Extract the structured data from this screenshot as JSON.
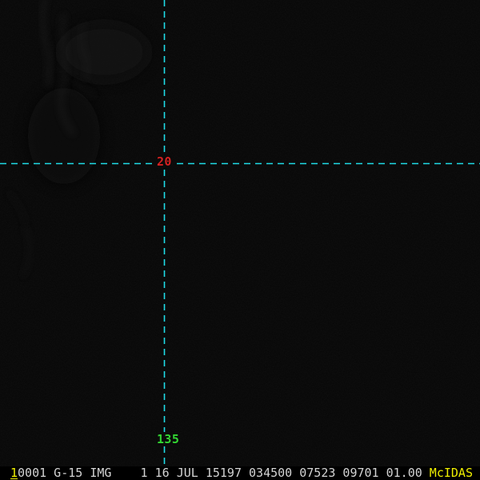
{
  "app": {
    "name": "McIDAS satellite image display"
  },
  "colors": {
    "background": "#060606",
    "status_bar_bg": "#000000",
    "crosshair": "#1fdde8",
    "latitude_label": "#d42222",
    "longitude_label": "#33d633",
    "status_text": "#d4d4d4",
    "accent_yellow": "#f0f000"
  },
  "crosshair": {
    "latitude_label": "20",
    "longitude_label": "135"
  },
  "status_bar": {
    "frame_number": "1",
    "info_text": "0001 G-15 IMG    1 16 JUL 15197 034500 07523 09701 01.00 ",
    "brand": "McIDAS"
  }
}
